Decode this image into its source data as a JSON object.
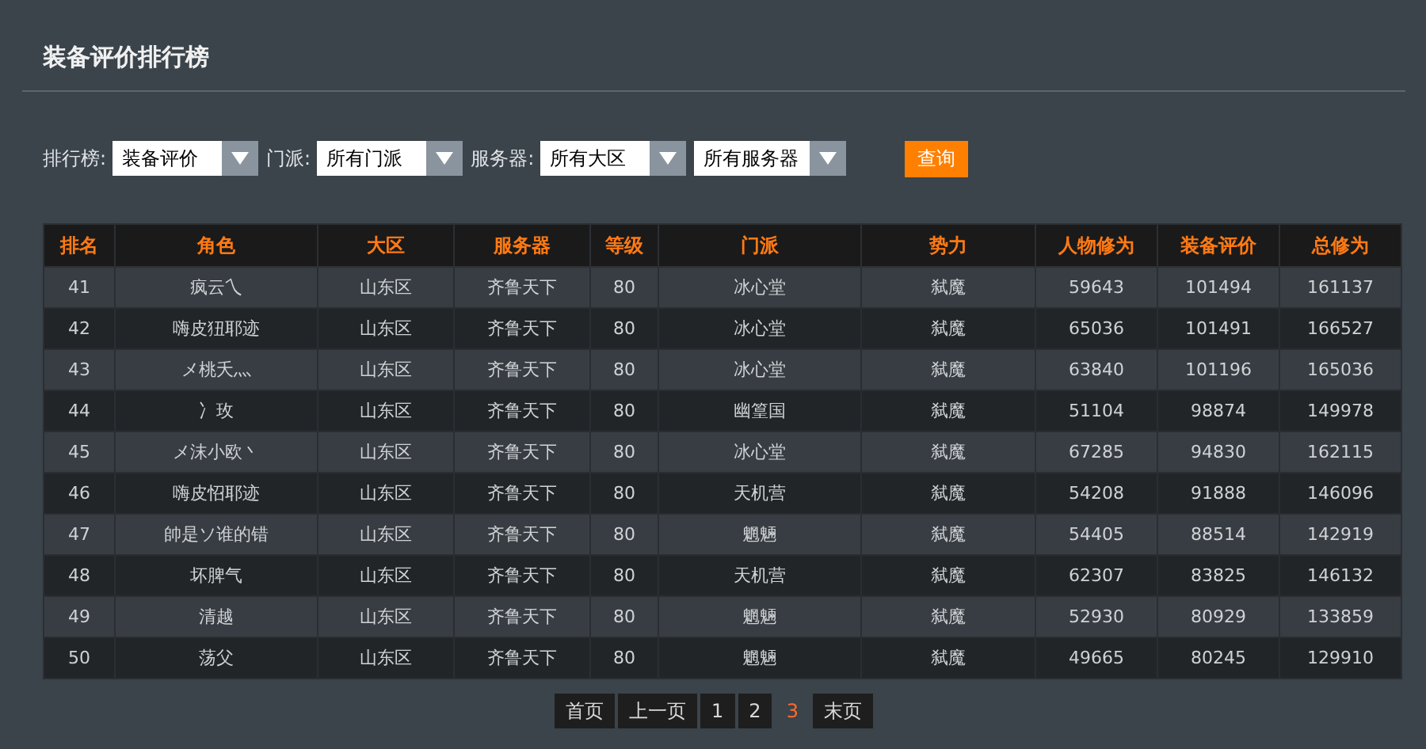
{
  "title": "装备评价排行榜",
  "filters": [
    {
      "label": "排行榜:",
      "value": "装备评价"
    },
    {
      "label": "门派:",
      "value": "所有门派"
    },
    {
      "label": "服务器:",
      "value": "所有大区"
    },
    {
      "value": "所有服务器"
    }
  ],
  "query_button": "查询",
  "table": {
    "columns": [
      "排名",
      "角色",
      "大区",
      "服务器",
      "等级",
      "门派",
      "势力",
      "人物修为",
      "装备评价",
      "总修为"
    ],
    "rows": [
      [
        "41",
        "疯云乀",
        "山东区",
        "齐鲁天下",
        "80",
        "冰心堂",
        "弑魔",
        "59643",
        "101494",
        "161137"
      ],
      [
        "42",
        "嗨皮狃耶迹",
        "山东区",
        "齐鲁天下",
        "80",
        "冰心堂",
        "弑魔",
        "65036",
        "101491",
        "166527"
      ],
      [
        "43",
        "メ桃夭灬",
        "山东区",
        "齐鲁天下",
        "80",
        "冰心堂",
        "弑魔",
        "63840",
        "101196",
        "165036"
      ],
      [
        "44",
        "冫玫",
        "山东区",
        "齐鲁天下",
        "80",
        "幽篁国",
        "弑魔",
        "51104",
        "98874",
        "149978"
      ],
      [
        "45",
        "メ沫小欧丶",
        "山东区",
        "齐鲁天下",
        "80",
        "冰心堂",
        "弑魔",
        "67285",
        "94830",
        "162115"
      ],
      [
        "46",
        "嗨皮怊耶迹",
        "山东区",
        "齐鲁天下",
        "80",
        "天机营",
        "弑魔",
        "54208",
        "91888",
        "146096"
      ],
      [
        "47",
        "帥是ソ谁的错",
        "山东区",
        "齐鲁天下",
        "80",
        "魍魎",
        "弑魔",
        "54405",
        "88514",
        "142919"
      ],
      [
        "48",
        "坏脾气",
        "山东区",
        "齐鲁天下",
        "80",
        "天机营",
        "弑魔",
        "62307",
        "83825",
        "146132"
      ],
      [
        "49",
        "清越",
        "山东区",
        "齐鲁天下",
        "80",
        "魍魎",
        "弑魔",
        "52930",
        "80929",
        "133859"
      ],
      [
        "50",
        "荡父",
        "山东区",
        "齐鲁天下",
        "80",
        "魍魎",
        "弑魔",
        "49665",
        "80245",
        "129910"
      ]
    ]
  },
  "pagination": [
    {
      "label": "首页",
      "selected": false
    },
    {
      "label": "上一页",
      "selected": false
    },
    {
      "label": "1",
      "selected": false
    },
    {
      "label": "2",
      "selected": false
    },
    {
      "label": "3",
      "selected": true
    },
    {
      "label": "末页",
      "selected": false
    }
  ]
}
